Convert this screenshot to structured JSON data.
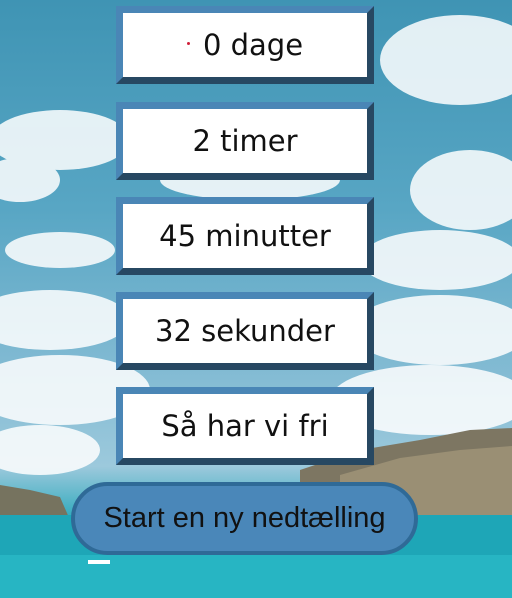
{
  "countdown": {
    "days": "0 dage",
    "hours": "2 timer",
    "minutes": "45 minutter",
    "seconds": "32 sekunder",
    "message": "Så har vi fri"
  },
  "actions": {
    "new_countdown_label": "Start en ny nedtælling"
  },
  "colors": {
    "box_border": "#4a86b6",
    "button_bg": "#4a87b9",
    "button_border": "#2f6a97",
    "marker_dot": "#d0203a"
  }
}
